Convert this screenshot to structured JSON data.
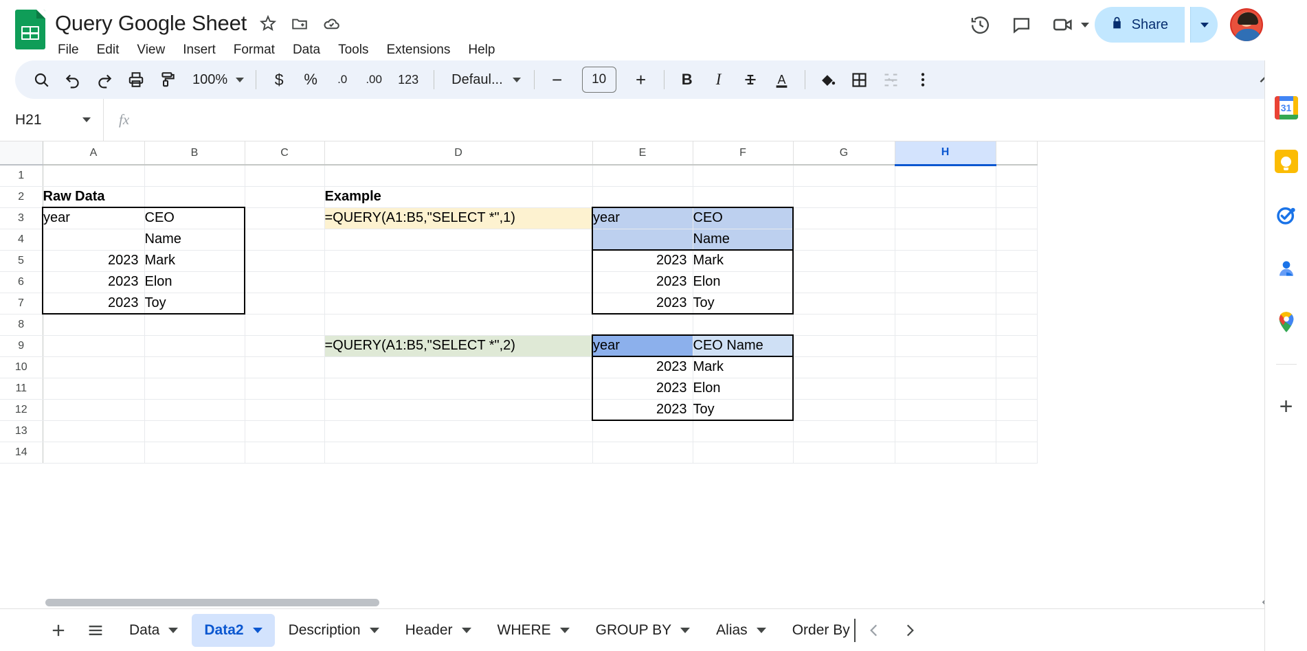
{
  "header": {
    "doc_title": "Query Google Sheet",
    "logo_icon": "google-sheets-icon",
    "star_icon": "star-icon",
    "move_icon": "move-to-folder-icon",
    "cloud_icon": "cloud-saved-icon",
    "menus": [
      "File",
      "Edit",
      "View",
      "Insert",
      "Format",
      "Data",
      "Tools",
      "Extensions",
      "Help"
    ],
    "history_icon": "version-history-icon",
    "comment_icon": "comment-icon",
    "meet_icon": "video-camera-icon",
    "share_label": "Share",
    "lock_icon": "lock-icon",
    "avatar_name": "user-avatar"
  },
  "toolbar": {
    "search_icon": "search-icon",
    "undo_icon": "undo-icon",
    "redo_icon": "redo-icon",
    "print_icon": "print-icon",
    "paint_icon": "paint-format-icon",
    "zoom_value": "100%",
    "currency_label": "$",
    "percent_label": "%",
    "decimal_dec_label": ".0",
    "decimal_inc_label": ".00",
    "more_formats_label": "123",
    "font_value": "Defaul...",
    "font_decrease": "−",
    "font_size": "10",
    "font_increase": "+",
    "bold_label": "B",
    "italic_label": "I",
    "strike_label": "S",
    "text_color_label": "A",
    "fill_icon": "fill-color-icon",
    "borders_icon": "borders-icon",
    "merge_icon": "merge-cells-icon",
    "more_icon": "more-options-icon",
    "collapse_icon": "collapse-toolbar-icon"
  },
  "formula_bar": {
    "name_box_value": "H21",
    "fx_label": "fx",
    "formula_value": "",
    "formula_placeholder": ""
  },
  "grid": {
    "columns": [
      "A",
      "B",
      "C",
      "D",
      "E",
      "F",
      "G",
      "H"
    ],
    "selected_column": "H",
    "rows": [
      "1",
      "2",
      "3",
      "4",
      "5",
      "6",
      "7",
      "8",
      "9",
      "10",
      "11",
      "12",
      "13",
      "14"
    ],
    "cells": {
      "A2": "Raw Data",
      "A3": "year",
      "A5": "2023",
      "A6": "2023",
      "A7": "2023",
      "B3": "CEO",
      "B4": "Name",
      "B5": "Mark",
      "B6": "Elon",
      "B7": "Toy",
      "D2": "Example",
      "D3": "=QUERY(A1:B5,\"SELECT *\",1)",
      "D9": "=QUERY(A1:B5,\"SELECT *\",2)",
      "E3": "year",
      "E5": "2023",
      "E6": "2023",
      "E7": "2023",
      "F3": "CEO",
      "F4": "Name",
      "F5": "Mark",
      "F6": "Elon",
      "F7": "Toy",
      "E9": "year",
      "F9": "CEO Name",
      "E10": "2023",
      "E11": "2023",
      "E12": "2023",
      "F10": "Mark",
      "F11": "Elon",
      "F12": "Toy"
    },
    "colors": {
      "formula_highlight_1": "#fdf2d0",
      "formula_highlight_2": "#dfe9d6",
      "result_header_light": "#bdd0ef",
      "result_header_strong": "#8cb0ec",
      "result_header_pale": "#cfe0f5",
      "selected_header": "#d3e3fd",
      "accent": "#0b57d0"
    }
  },
  "tabs": {
    "add_sheet_icon": "add-sheet-icon",
    "all_sheets_icon": "all-sheets-menu-icon",
    "items": [
      {
        "label": "Data",
        "active": false
      },
      {
        "label": "Data2",
        "active": true
      },
      {
        "label": "Description",
        "active": false
      },
      {
        "label": "Header",
        "active": false
      },
      {
        "label": "WHERE",
        "active": false
      },
      {
        "label": "GROUP BY",
        "active": false
      },
      {
        "label": "Alias",
        "active": false
      },
      {
        "label": "Order By",
        "active": false
      }
    ],
    "prev_icon": "chevron-left-icon",
    "next_icon": "chevron-right-icon"
  },
  "side_rail": {
    "items": [
      {
        "name": "google-calendar-icon",
        "label": "31"
      },
      {
        "name": "google-keep-icon",
        "label": ""
      },
      {
        "name": "google-tasks-icon",
        "label": ""
      },
      {
        "name": "google-contacts-icon",
        "label": ""
      },
      {
        "name": "google-maps-icon",
        "label": ""
      }
    ],
    "add_on_icon": "add-ons-icon",
    "add_on_label": "+"
  }
}
